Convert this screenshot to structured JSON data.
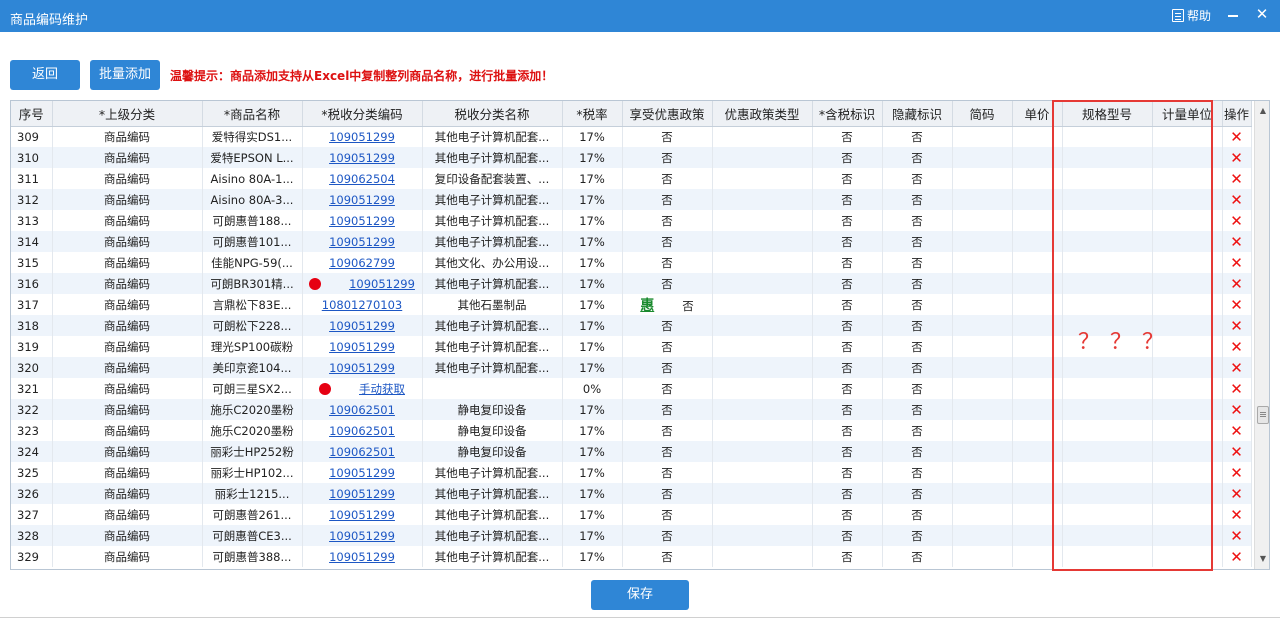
{
  "window": {
    "title": "商品编码维护",
    "help_label": "帮助",
    "close_glyph": "✕",
    "accent_color": "#2f86d6"
  },
  "toolbar": {
    "back_label": "返回",
    "batch_add_label": "批量添加",
    "tip_text": "温馨提示：商品添加支持从Excel中复制整列商品名称，进行批量添加！"
  },
  "table": {
    "columns": [
      "序号",
      "*上级分类",
      "*商品名称",
      "*税收分类编码",
      "税收分类名称",
      "*税率",
      "享受优惠政策",
      "优惠政策类型",
      "*含税标识",
      "隐藏标识",
      "简码",
      "单价",
      "规格型号",
      "计量单位",
      "操作"
    ],
    "rows": [
      {
        "seq": "309",
        "parent": "商品编码",
        "name": "爱特得实DS1...",
        "code": "109051299",
        "code_name": "其他电子计算机配套...",
        "rate": "17%",
        "pref": "否",
        "tax_incl": "否",
        "hidden": "否"
      },
      {
        "seq": "310",
        "parent": "商品编码",
        "name": "爱特EPSON L...",
        "code": "109051299",
        "code_name": "其他电子计算机配套...",
        "rate": "17%",
        "pref": "否",
        "tax_incl": "否",
        "hidden": "否"
      },
      {
        "seq": "311",
        "parent": "商品编码",
        "name": "Aisino 80A-1...",
        "code": "109062504",
        "code_name": "复印设备配套装置、...",
        "rate": "17%",
        "pref": "否",
        "tax_incl": "否",
        "hidden": "否"
      },
      {
        "seq": "312",
        "parent": "商品编码",
        "name": "Aisino 80A-3...",
        "code": "109051299",
        "code_name": "其他电子计算机配套...",
        "rate": "17%",
        "pref": "否",
        "tax_incl": "否",
        "hidden": "否"
      },
      {
        "seq": "313",
        "parent": "商品编码",
        "name": "可朗惠普188...",
        "code": "109051299",
        "code_name": "其他电子计算机配套...",
        "rate": "17%",
        "pref": "否",
        "tax_incl": "否",
        "hidden": "否"
      },
      {
        "seq": "314",
        "parent": "商品编码",
        "name": "可朗惠普101...",
        "code": "109051299",
        "code_name": "其他电子计算机配套...",
        "rate": "17%",
        "pref": "否",
        "tax_incl": "否",
        "hidden": "否"
      },
      {
        "seq": "315",
        "parent": "商品编码",
        "name": "佳能NPG-59(...",
        "code": "109062799",
        "code_name": "其他文化、办公用设...",
        "rate": "17%",
        "pref": "否",
        "tax_incl": "否",
        "hidden": "否"
      },
      {
        "seq": "316",
        "parent": "商品编码",
        "name": "可朗BR301精...",
        "code": "109051299",
        "code_name": "其他电子计算机配套...",
        "rate": "17%",
        "pref": "否",
        "tax_incl": "否",
        "hidden": "否",
        "dot": true
      },
      {
        "seq": "317",
        "parent": "商品编码",
        "name": "言鼎松下83E...",
        "code": "10801270103",
        "code_name": "其他石墨制品",
        "rate": "17%",
        "pref": "否",
        "tax_incl": "否",
        "hidden": "否",
        "hui": "惠"
      },
      {
        "seq": "318",
        "parent": "商品编码",
        "name": "可朗松下228...",
        "code": "109051299",
        "code_name": "其他电子计算机配套...",
        "rate": "17%",
        "pref": "否",
        "tax_incl": "否",
        "hidden": "否"
      },
      {
        "seq": "319",
        "parent": "商品编码",
        "name": "理光SP100碳粉",
        "code": "109051299",
        "code_name": "其他电子计算机配套...",
        "rate": "17%",
        "pref": "否",
        "tax_incl": "否",
        "hidden": "否"
      },
      {
        "seq": "320",
        "parent": "商品编码",
        "name": "美印京瓷104...",
        "code": "109051299",
        "code_name": "其他电子计算机配套...",
        "rate": "17%",
        "pref": "否",
        "tax_incl": "否",
        "hidden": "否"
      },
      {
        "seq": "321",
        "parent": "商品编码",
        "name": "可朗三星SX2...",
        "code": "手动获取",
        "code_name": "",
        "rate": "0%",
        "pref": "否",
        "tax_incl": "否",
        "hidden": "否",
        "dot": true
      },
      {
        "seq": "322",
        "parent": "商品编码",
        "name": "施乐C2020墨粉",
        "code": "109062501",
        "code_name": "静电复印设备",
        "rate": "17%",
        "pref": "否",
        "tax_incl": "否",
        "hidden": "否"
      },
      {
        "seq": "323",
        "parent": "商品编码",
        "name": "施乐C2020墨粉",
        "code": "109062501",
        "code_name": "静电复印设备",
        "rate": "17%",
        "pref": "否",
        "tax_incl": "否",
        "hidden": "否"
      },
      {
        "seq": "324",
        "parent": "商品编码",
        "name": "丽彩士HP252粉",
        "code": "109062501",
        "code_name": "静电复印设备",
        "rate": "17%",
        "pref": "否",
        "tax_incl": "否",
        "hidden": "否"
      },
      {
        "seq": "325",
        "parent": "商品编码",
        "name": "丽彩士HP102...",
        "code": "109051299",
        "code_name": "其他电子计算机配套...",
        "rate": "17%",
        "pref": "否",
        "tax_incl": "否",
        "hidden": "否"
      },
      {
        "seq": "326",
        "parent": "商品编码",
        "name": "丽彩士1215...",
        "code": "109051299",
        "code_name": "其他电子计算机配套...",
        "rate": "17%",
        "pref": "否",
        "tax_incl": "否",
        "hidden": "否"
      },
      {
        "seq": "327",
        "parent": "商品编码",
        "name": "可朗惠普261...",
        "code": "109051299",
        "code_name": "其他电子计算机配套...",
        "rate": "17%",
        "pref": "否",
        "tax_incl": "否",
        "hidden": "否"
      },
      {
        "seq": "328",
        "parent": "商品编码",
        "name": "可朗惠普CE3...",
        "code": "109051299",
        "code_name": "其他电子计算机配套...",
        "rate": "17%",
        "pref": "否",
        "tax_incl": "否",
        "hidden": "否"
      },
      {
        "seq": "329",
        "parent": "商品编码",
        "name": "可朗惠普388...",
        "code": "109051299",
        "code_name": "其他电子计算机配套...",
        "rate": "17%",
        "pref": "否",
        "tax_incl": "否",
        "hidden": "否"
      }
    ],
    "delete_glyph": "✕"
  },
  "annotation": {
    "question_marks": "？？？",
    "highlight_color": "#e53935"
  },
  "footer": {
    "save_label": "保存"
  }
}
